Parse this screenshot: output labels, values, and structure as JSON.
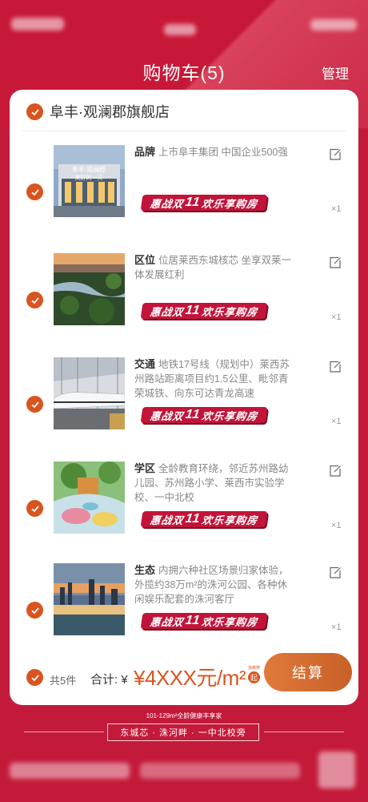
{
  "header": {
    "title": "购物车(5)",
    "manage_label": "管理"
  },
  "store": {
    "name": "阜丰·观澜郡旗舰店"
  },
  "promo": {
    "pre": "惠战双",
    "hl": "11",
    "post": " 欢乐享购房"
  },
  "thumb1_text": {
    "line1": "阜丰·观澜郡",
    "line2": "美好的一天"
  },
  "items": [
    {
      "tag": "品牌",
      "text": "上市阜丰集团 中国企业500强",
      "qty": "×1"
    },
    {
      "tag": "区位",
      "text": "位居莱西东城核芯 坐享双莱一体发展红利",
      "qty": "×1"
    },
    {
      "tag": "交通",
      "text": "地铁17号线（规划中）莱西苏州路站距离项目约1.5公里、毗邻青荣城铁、向东可达青龙高速",
      "qty": "×1"
    },
    {
      "tag": "学区",
      "text": "全龄教育环绕，邻近苏州路幼儿园、苏州路小学、莱西市实验学校、一中北校",
      "qty": "×1"
    },
    {
      "tag": "生态",
      "text": "内拥六种社区场景归家体验，外揽约38万m²的洙河公园、各种休闲娱乐配套的洙河客厅",
      "qty": "×1"
    }
  ],
  "footer": {
    "count": "共5件",
    "total_label": "合计: ¥",
    "price": "¥4XXX元/m²",
    "qi_small": "加装修",
    "qi": "起",
    "checkout": "结算"
  },
  "bottom": {
    "tagline": "101-129m²全龄健康丰享家",
    "slogan": "东城芯 · 洙河畔 · 一中北校旁"
  },
  "colors": {
    "primary_red": "#c41a3a",
    "accent_orange": "#d9541f"
  }
}
